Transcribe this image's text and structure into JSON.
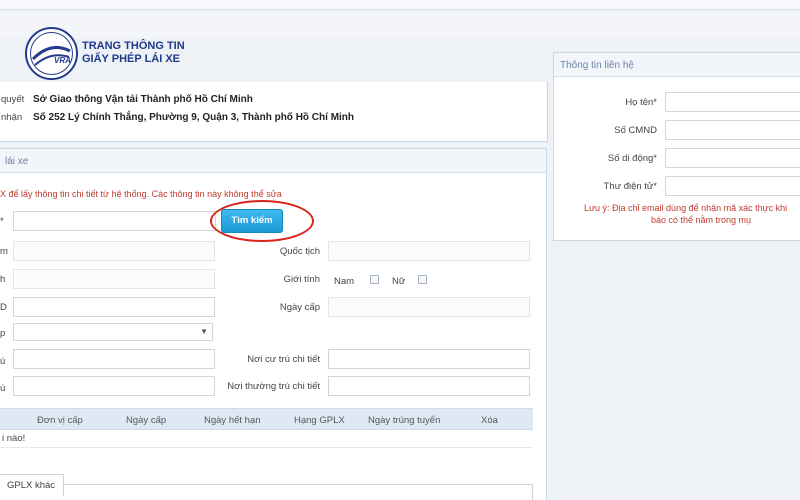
{
  "header": {
    "title_line1": "TRANG THÔNG TIN",
    "title_line2": "GIẤY PHÉP LÁI XE",
    "logo_text": "VRA",
    "logo_ring_text": "CỤC ĐƯỜNG BỘ VIỆT NAM"
  },
  "authority": {
    "label1": "quyết",
    "value1": "Sở Giao thông Vận tải Thành phố Hồ Chí Minh",
    "label2": "nhận",
    "value2": "Số 252 Lý Chính Thắng, Phường 9, Quận 3, Thành phố Hồ Chí Minh"
  },
  "license_panel": {
    "title": "lái xe",
    "note": "X để lấy thông tin chi tiết từ hệ thống. Các thông tin này không thể sửa",
    "row1_label": "*",
    "search_button": "Tìm kiếm",
    "row2_label": "m",
    "nationality_label": "Quốc tịch",
    "row3_label": "h",
    "gender_label": "Giới tính",
    "male": "Nam",
    "female": "Nữ",
    "row4_label": "D",
    "issue_date_label": "Ngày cấp",
    "row5_label": "p",
    "row6_label": "ú",
    "residence_detail_label": "Nơi cư trú chi tiết",
    "row7_label": "ú",
    "permanent_detail_label": "Nơi thường trú chi tiết"
  },
  "table": {
    "headers": [
      "Đơn vị cấp",
      "Ngày cấp",
      "Ngày hết hạn",
      "Hạng GPLX",
      "Ngày trúng tuyển",
      "Xóa"
    ],
    "empty_text": "i nào!"
  },
  "bottom_tab": "GPLX khác",
  "contact_panel": {
    "title": "Thông tin liên hệ",
    "name_label": "Họ tên*",
    "id_label": "Số CMND",
    "phone_label": "Số di động*",
    "email_label": "Thư điện tử*",
    "note_line1": "Lưu ý: Địa chỉ email dùng để nhận mã xác thực khi",
    "note_line2": "báo có thể nằm trong mụ"
  }
}
